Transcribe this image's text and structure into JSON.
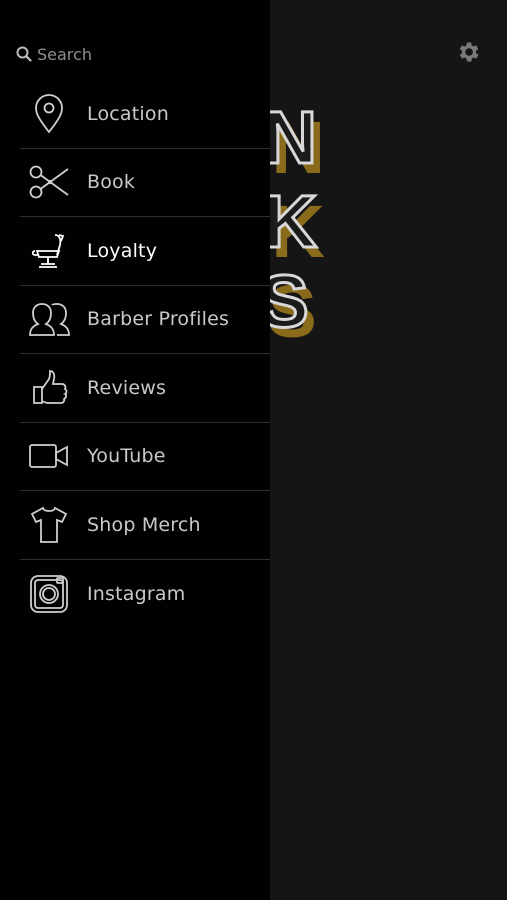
{
  "search": {
    "placeholder": "Search"
  },
  "menu": {
    "items": [
      {
        "label": "Location",
        "icon": "map-pin-icon"
      },
      {
        "label": "Book",
        "icon": "scissors-icon"
      },
      {
        "label": "Loyalty",
        "icon": "barber-chair-icon",
        "active": true
      },
      {
        "label": "Barber Profiles",
        "icon": "people-icon"
      },
      {
        "label": "Reviews",
        "icon": "thumbs-up-icon"
      },
      {
        "label": "YouTube",
        "icon": "video-camera-icon"
      },
      {
        "label": "Shop Merch",
        "icon": "t-shirt-icon"
      },
      {
        "label": "Instagram",
        "icon": "instagram-icon"
      }
    ]
  },
  "header": {
    "settings_icon": "gear-icon"
  },
  "theme": {
    "accent": "#8a6b1c",
    "drawer_bg": "#010101",
    "main_bg": "#151515",
    "text": "#c9c9c9"
  }
}
